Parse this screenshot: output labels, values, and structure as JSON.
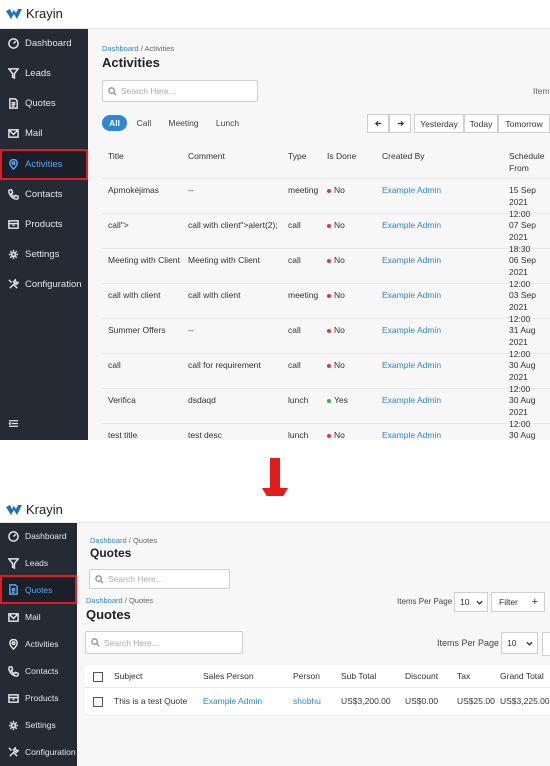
{
  "app_name": "Krayin",
  "sidebar": {
    "items": [
      {
        "label": "Dashboard",
        "icon": "dashboard-icon"
      },
      {
        "label": "Leads",
        "icon": "funnel-icon"
      },
      {
        "label": "Quotes",
        "icon": "document-icon"
      },
      {
        "label": "Mail",
        "icon": "mail-icon"
      },
      {
        "label": "Activities",
        "icon": "pin-icon"
      },
      {
        "label": "Contacts",
        "icon": "phone-icon"
      },
      {
        "label": "Products",
        "icon": "box-icon"
      },
      {
        "label": "Settings",
        "icon": "gear-icon"
      },
      {
        "label": "Configuration",
        "icon": "wrench-icon"
      }
    ]
  },
  "activities": {
    "breadcrumb_root": "Dashboard",
    "breadcrumb_current": "Activities",
    "title": "Activities",
    "search_placeholder": "Search Here...",
    "items_label": "Item",
    "filters": [
      "All",
      "Call",
      "Meeting",
      "Lunch"
    ],
    "date_buttons": [
      "Yesterday",
      "Today",
      "Tomorrow"
    ],
    "columns": [
      "Title",
      "Comment",
      "Type",
      "Is Done",
      "Created By",
      "Schedule From"
    ],
    "rows": [
      {
        "title": "Apmokėjimas",
        "comment": "--",
        "type": "meeting",
        "done": "No",
        "by": "Example Admin",
        "date": "15 Sep",
        "time": "2021 12:00"
      },
      {
        "title": "call\">",
        "comment": "call with client\">alert(2);",
        "type": "call",
        "done": "No",
        "by": "Example Admin",
        "date": "07 Sep",
        "time": "2021 18:30"
      },
      {
        "title": "Meeting with Client",
        "comment": "Meeting with Client",
        "type": "call",
        "done": "No",
        "by": "Example Admin",
        "date": "06 Sep",
        "time": "2021 12:00"
      },
      {
        "title": "call with client",
        "comment": "call with client",
        "type": "meeting",
        "done": "No",
        "by": "Example Admin",
        "date": "03 Sep",
        "time": "2021 12:00"
      },
      {
        "title": "Summer Offers",
        "comment": "--",
        "type": "call",
        "done": "No",
        "by": "Example Admin",
        "date": "31 Aug",
        "time": "2021 12:00"
      },
      {
        "title": "call",
        "comment": "call for requirement",
        "type": "call",
        "done": "No",
        "by": "Example Admin",
        "date": "30 Aug",
        "time": "2021 12:00"
      },
      {
        "title": "Verifica",
        "comment": "dsdaqd",
        "type": "lunch",
        "done": "Yes",
        "by": "Example Admin",
        "date": "30 Aug",
        "time": "2021 12:00"
      },
      {
        "title": "test title",
        "comment": "test desc",
        "type": "lunch",
        "done": "No",
        "by": "Example Admin",
        "date": "30 Aug",
        "time": ""
      }
    ]
  },
  "quotes": {
    "breadcrumb_root": "Dashboard",
    "breadcrumb_current": "Quotes",
    "title": "Quotes",
    "search_placeholder": "Search Here...",
    "items_per_page_label": "Items Per Page",
    "items_per_page_value": "10",
    "filter_label": "Filter",
    "columns": [
      "Subject",
      "Sales Person",
      "Person",
      "Sub Total",
      "Discount",
      "Tax",
      "Grand Total"
    ],
    "rows": [
      {
        "subject": "This is a test Quote",
        "sales_person": "Example Admin",
        "person": "shobhu",
        "sub_total": "US$3,200.00",
        "discount": "US$0.00",
        "tax": "US$25.00",
        "grand_total": "US$3,225.00"
      }
    ]
  },
  "colors": {
    "accent": "#2f86d4",
    "sidebar": "#252b35",
    "highlight": "#e01b22",
    "arrow": "#e21b1b"
  }
}
